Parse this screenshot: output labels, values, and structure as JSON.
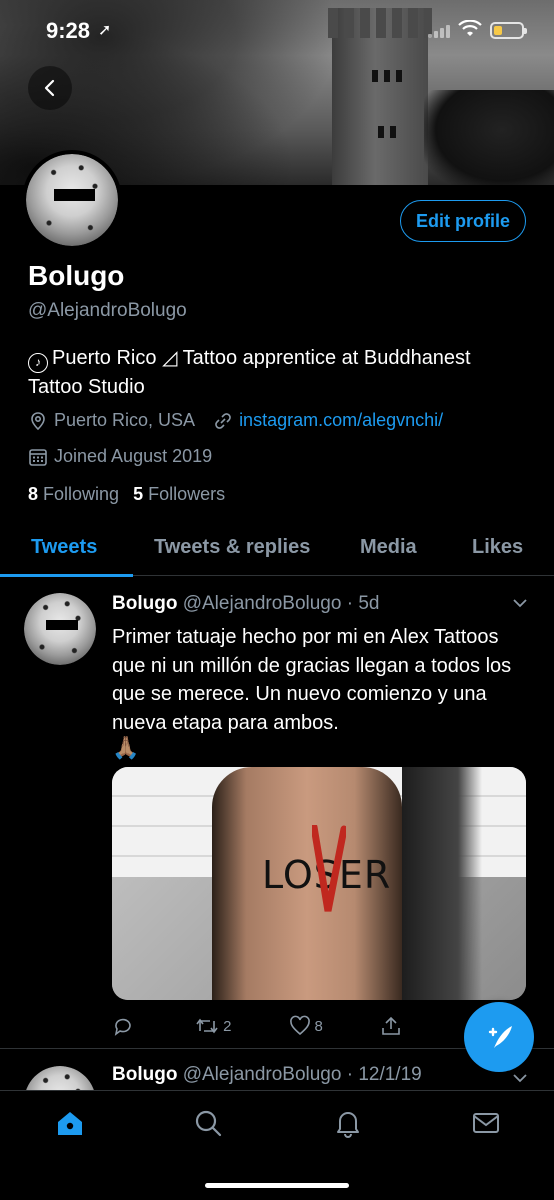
{
  "status": {
    "time": "9:28",
    "location_icon": "location-arrow-icon"
  },
  "profile": {
    "name": "Bolugo",
    "handle": "@AlejandroBolugo",
    "edit_label": "Edit profile",
    "bio_line1": "Puerto Rico ◿ Tattoo apprentice at Buddhanest",
    "bio_line2": "Tattoo Studio",
    "location": "Puerto Rico, USA",
    "website": "instagram.com/alegvnchi/",
    "joined": "Joined August 2019",
    "following_count": "8",
    "following_label": "Following",
    "followers_count": "5",
    "followers_label": "Followers"
  },
  "tabs": [
    {
      "label": "Tweets",
      "active": true
    },
    {
      "label": "Tweets & replies",
      "active": false
    },
    {
      "label": "Media",
      "active": false
    },
    {
      "label": "Likes",
      "active": false
    }
  ],
  "tweets": [
    {
      "name": "Bolugo",
      "handle_time": "@AlejandroBolugo · 5d",
      "text": "Primer tatuaje hecho por mi en Alex Tattoos que ni un millón de gracias llegan a todos los que se merece. Un nuevo comienzo y una nueva etapa para ambos.",
      "emoji": "🙏🏽",
      "media_text": "LOSER",
      "replies": "",
      "retweets": "2",
      "likes": "8"
    },
    {
      "name": "Bolugo",
      "handle_time": "@AlejandroBolugo · 12/1/19"
    }
  ],
  "colors": {
    "accent": "#1d9bf0",
    "muted": "#8b98a5",
    "divider": "#2f3336"
  }
}
